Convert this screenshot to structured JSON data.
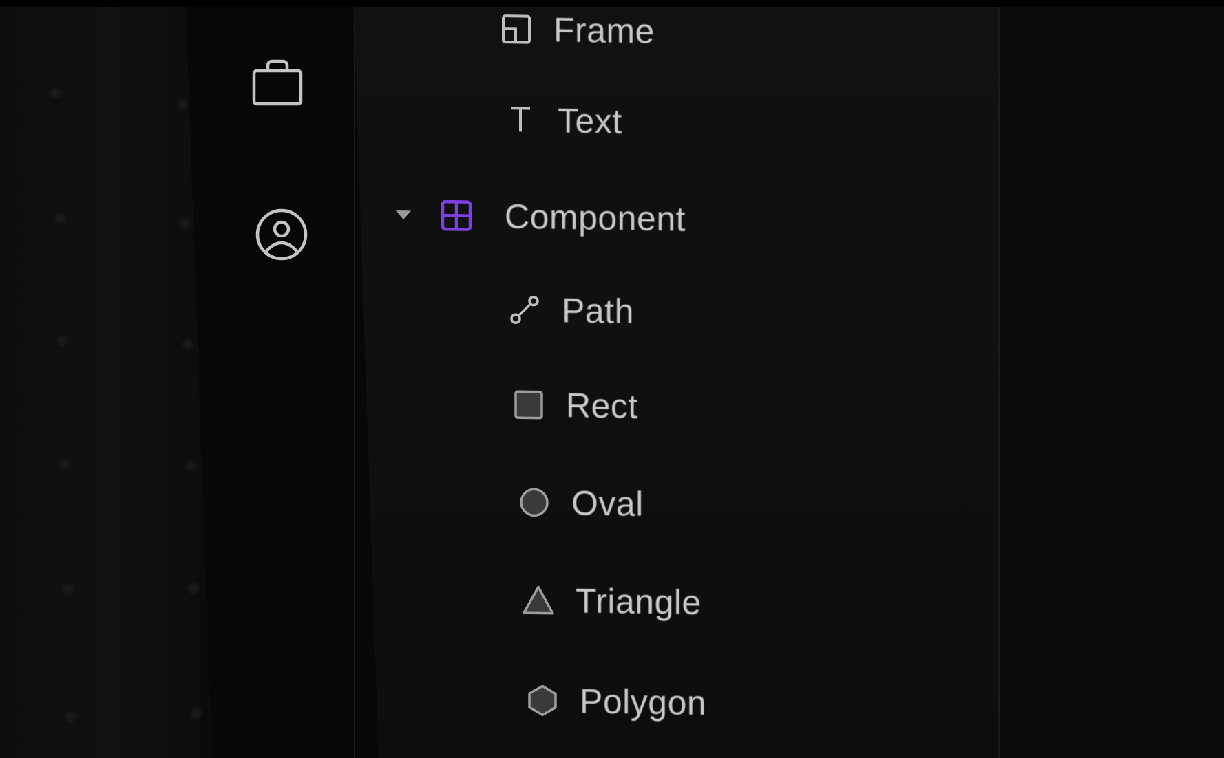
{
  "colors": {
    "accent": "#7b3fe4",
    "text": "#c9c9c9",
    "icon": "#bdbdbd",
    "icon_fill": "#3a3a3a",
    "background": "#0f0f0f"
  },
  "rail": {
    "items": [
      {
        "icon": "shopping-bag-icon"
      },
      {
        "icon": "user-circle-icon"
      }
    ]
  },
  "layers": {
    "items": [
      {
        "label": "Frame",
        "icon": "frame-icon"
      },
      {
        "label": "Text",
        "icon": "text-icon"
      },
      {
        "label": "Component",
        "icon": "component-icon",
        "expanded": true
      },
      {
        "label": "Path",
        "icon": "path-icon"
      },
      {
        "label": "Rect",
        "icon": "rect-icon"
      },
      {
        "label": "Oval",
        "icon": "oval-icon"
      },
      {
        "label": "Triangle",
        "icon": "triangle-icon"
      },
      {
        "label": "Polygon",
        "icon": "polygon-icon"
      }
    ]
  }
}
